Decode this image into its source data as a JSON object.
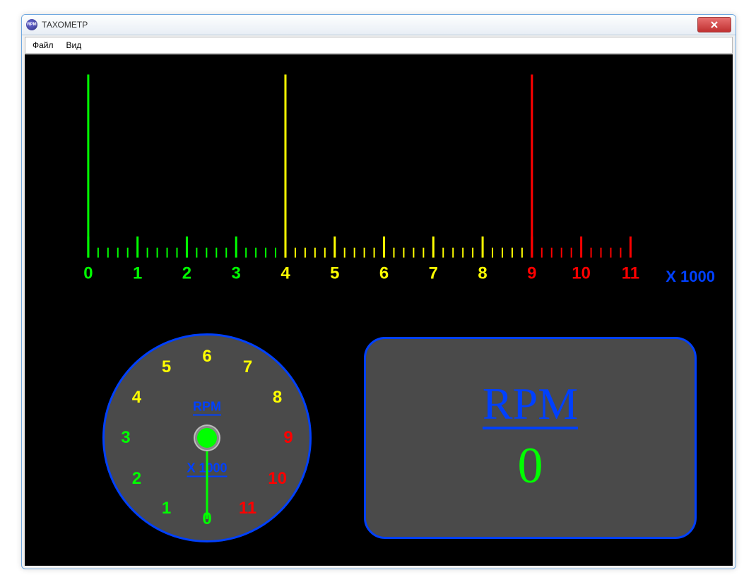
{
  "window": {
    "title": "ТАХОМЕТР",
    "app_icon_label": "RPM"
  },
  "menu": {
    "file": "Файл",
    "view": "Вид"
  },
  "scale": {
    "unit_label": "X 1000",
    "max": 11,
    "green_end": 3,
    "yellow_end": 8,
    "markers": [
      {
        "at": 0,
        "color": "#00ff00"
      },
      {
        "at": 4,
        "color": "#ffff00"
      },
      {
        "at": 9,
        "color": "#ff0000"
      }
    ],
    "labels": [
      "0",
      "1",
      "2",
      "3",
      "4",
      "5",
      "6",
      "7",
      "8",
      "9",
      "10",
      "11"
    ]
  },
  "dial": {
    "rpm_label": "RPM",
    "x1000_label": "X 1000",
    "labels": [
      "0",
      "1",
      "2",
      "3",
      "4",
      "5",
      "6",
      "7",
      "8",
      "9",
      "10",
      "11"
    ],
    "green_end": 3,
    "yellow_end": 8
  },
  "readout": {
    "label": "RPM",
    "value": "0"
  }
}
